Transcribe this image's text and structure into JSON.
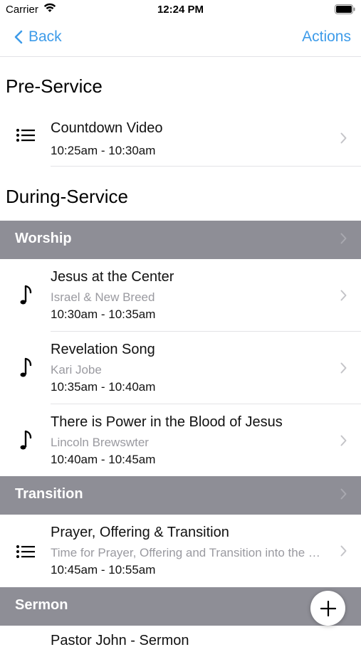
{
  "status_bar": {
    "carrier": "Carrier",
    "time": "12:24 PM"
  },
  "nav": {
    "back_label": "Back",
    "actions_label": "Actions"
  },
  "sections": {
    "pre_service": "Pre-Service",
    "during_service": "During-Service"
  },
  "items": [
    {
      "icon": "list-icon",
      "title": "Countdown Video",
      "subtitle": "",
      "time": "10:25am - 10:30am"
    },
    {
      "icon": "music-note-icon",
      "title": "Jesus at the Center",
      "subtitle": "Israel & New Breed",
      "time": "10:30am - 10:35am"
    },
    {
      "icon": "music-note-icon",
      "title": "Revelation Song",
      "subtitle": "Kari Jobe",
      "time": "10:35am - 10:40am"
    },
    {
      "icon": "music-note-icon",
      "title": "There is Power in the Blood of Jesus",
      "subtitle": "Lincoln Brewswter",
      "time": "10:40am - 10:45am"
    },
    {
      "icon": "list-icon",
      "title": "Prayer, Offering & Transition",
      "subtitle": "Time for Prayer, Offering and Transition into the Sermon",
      "time": "10:45am - 10:55am"
    },
    {
      "icon": "list-icon",
      "title": "Pastor John - Sermon",
      "subtitle": "",
      "time": ""
    }
  ],
  "groups": {
    "worship": "Worship",
    "transition": "Transition",
    "sermon": "Sermon"
  },
  "colors": {
    "accent": "#3d9be9",
    "group_header_bg": "#8e8e96",
    "subtitle": "#9a9aa0"
  }
}
